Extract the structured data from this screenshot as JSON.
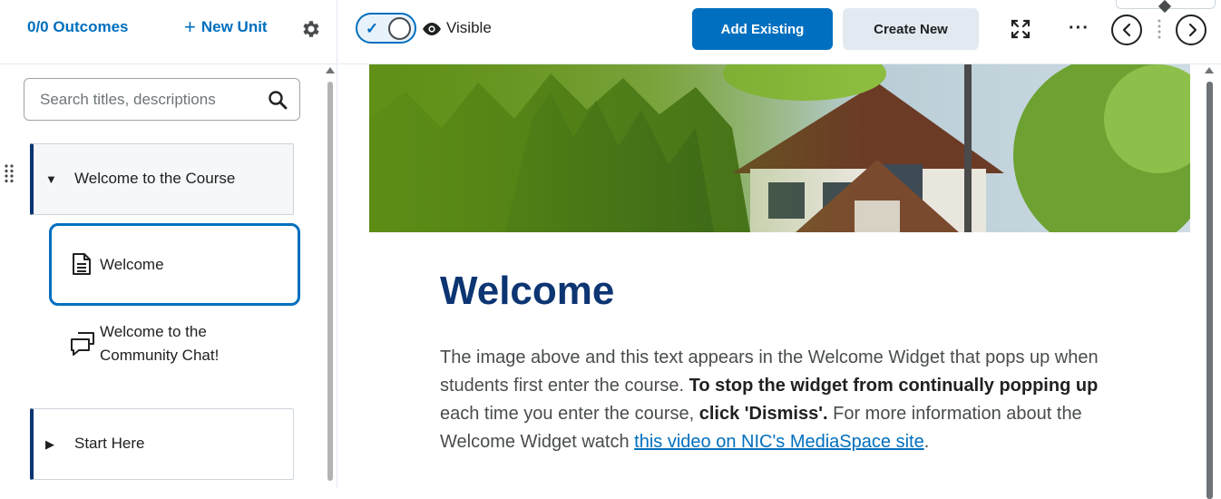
{
  "sidebar": {
    "outcomes_link": "0/0 Outcomes",
    "new_unit_label": "New Unit",
    "search_placeholder": "Search titles, descriptions",
    "units": [
      {
        "title": "Welcome to the Course",
        "state": "expanded"
      },
      {
        "title": "Start Here",
        "state": "collapsed"
      }
    ],
    "items": [
      {
        "label": "Welcome",
        "icon": "document-icon",
        "selected": true
      },
      {
        "label": "Welcome to the Community Chat!",
        "icon": "chat-icon",
        "selected": false
      }
    ]
  },
  "toolbar": {
    "visibility_label": "Visible",
    "visibility_on": true,
    "add_existing_label": "Add Existing",
    "create_new_label": "Create New"
  },
  "content": {
    "title": "Welcome",
    "body_1": "The image above and this text appears in the Welcome Widget that pops up when students first enter the course. ",
    "body_bold_1": "To stop the widget from continually popping up",
    "body_2": " each time you enter the course, ",
    "body_bold_2": "click 'Dismiss'.",
    "body_3": " For more information about the Welcome Widget watch ",
    "body_link": "this video on NIC's MediaSpace site",
    "body_4": "."
  },
  "colors": {
    "primary": "#006fbf",
    "heading": "#0c3572",
    "secondary_button": "#e3e9f1"
  }
}
